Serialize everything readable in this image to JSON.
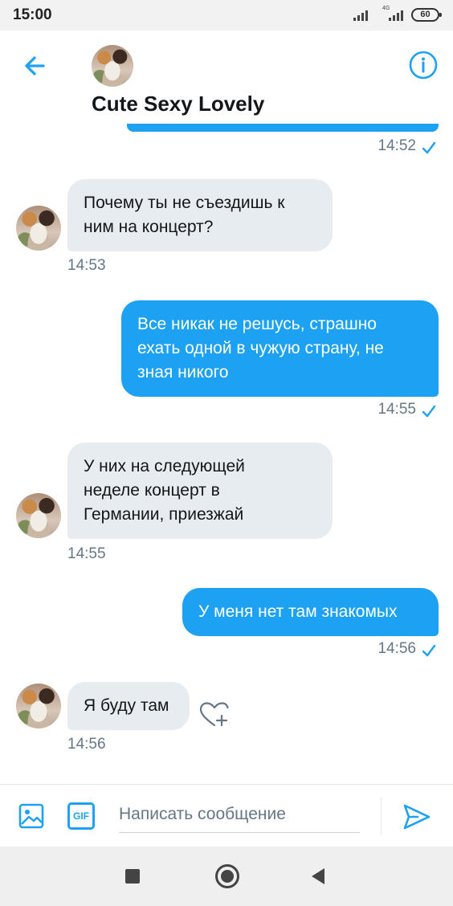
{
  "status_bar": {
    "time": "15:00",
    "network": "4G",
    "battery": "60"
  },
  "header": {
    "title": "Cute Sexy Lovely",
    "back_icon": "arrow-left-icon",
    "info_icon": "info-circle-icon"
  },
  "messages": [
    {
      "direction": "outgoing",
      "text": "",
      "time": "14:52",
      "read": true
    },
    {
      "direction": "incoming",
      "text": "Почему ты не съездишь к\nним на концерт?",
      "time": "14:53"
    },
    {
      "direction": "outgoing",
      "text": "Все никак не решусь, страшно\nехать одной в чужую страну, не\nзная никого",
      "time": "14:55",
      "read": true
    },
    {
      "direction": "incoming",
      "text": "У них на следующей\nнеделе концерт в\nГермании, приезжай",
      "time": "14:55"
    },
    {
      "direction": "outgoing",
      "text": "У меня нет там знакомых",
      "time": "14:56",
      "read": true
    },
    {
      "direction": "incoming",
      "text": "Я буду там",
      "time": "14:56"
    }
  ],
  "composer": {
    "placeholder": "Написать сообщение",
    "gif_label": "GIF",
    "media_icon": "image-icon",
    "send_icon": "send-icon"
  },
  "colors": {
    "accent": "#1da1f2",
    "incoming_bubble": "#e6ecf0",
    "timestamp": "#657786"
  }
}
